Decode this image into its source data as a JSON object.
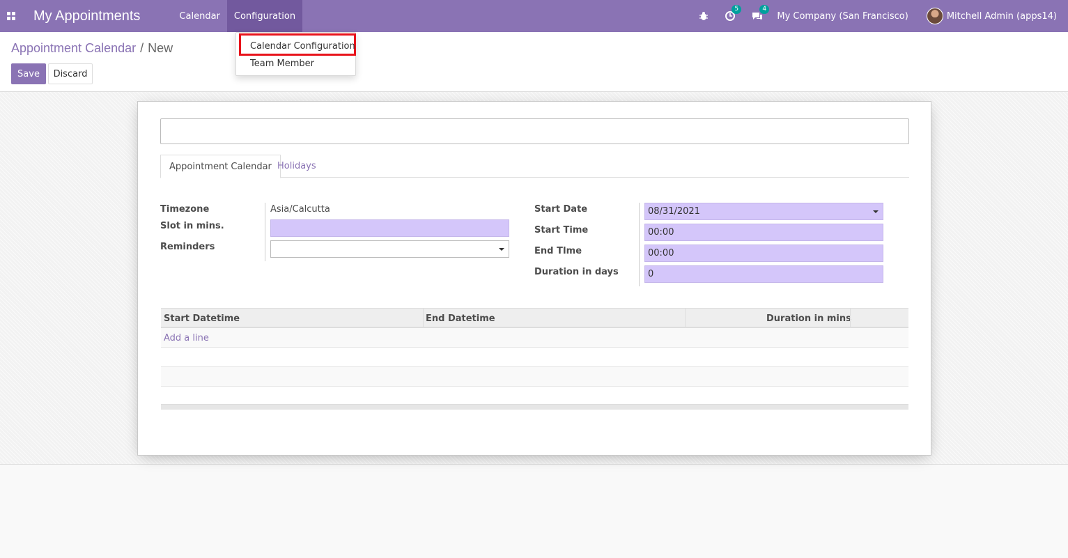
{
  "navbar": {
    "app_title": "My Appointments",
    "menu": [
      {
        "label": "Calendar"
      },
      {
        "label": "Configuration"
      }
    ],
    "activity_count": "5",
    "messages_count": "4",
    "company": "My Company (San Francisco)",
    "user": "Mitchell Admin (apps14)"
  },
  "dropdown": {
    "items": [
      {
        "label": "Calendar Configuration"
      },
      {
        "label": "Team Member"
      }
    ]
  },
  "breadcrumb": {
    "parent": "Appointment Calendar",
    "separator": "/",
    "current": "New"
  },
  "buttons": {
    "save": "Save",
    "discard": "Discard"
  },
  "form": {
    "name_value": "",
    "tabs": [
      {
        "label": "Appointment Calendar"
      },
      {
        "label": "Holidays"
      }
    ],
    "left": {
      "timezone_label": "Timezone",
      "timezone_value": "Asia/Calcutta",
      "slot_label": "Slot in mins.",
      "slot_value": "",
      "reminders_label": "Reminders",
      "reminders_value": ""
    },
    "right": {
      "start_date_label": "Start Date",
      "start_date_value": "08/31/2021",
      "start_time_label": "Start Time",
      "start_time_value": "00:00",
      "end_time_label": "End TIme",
      "end_time_value": "00:00",
      "duration_label": "Duration in days",
      "duration_value": "0"
    },
    "table": {
      "columns": [
        "Start Datetime",
        "End Datetime",
        "Duration in mins"
      ],
      "add_line": "Add a line"
    }
  }
}
